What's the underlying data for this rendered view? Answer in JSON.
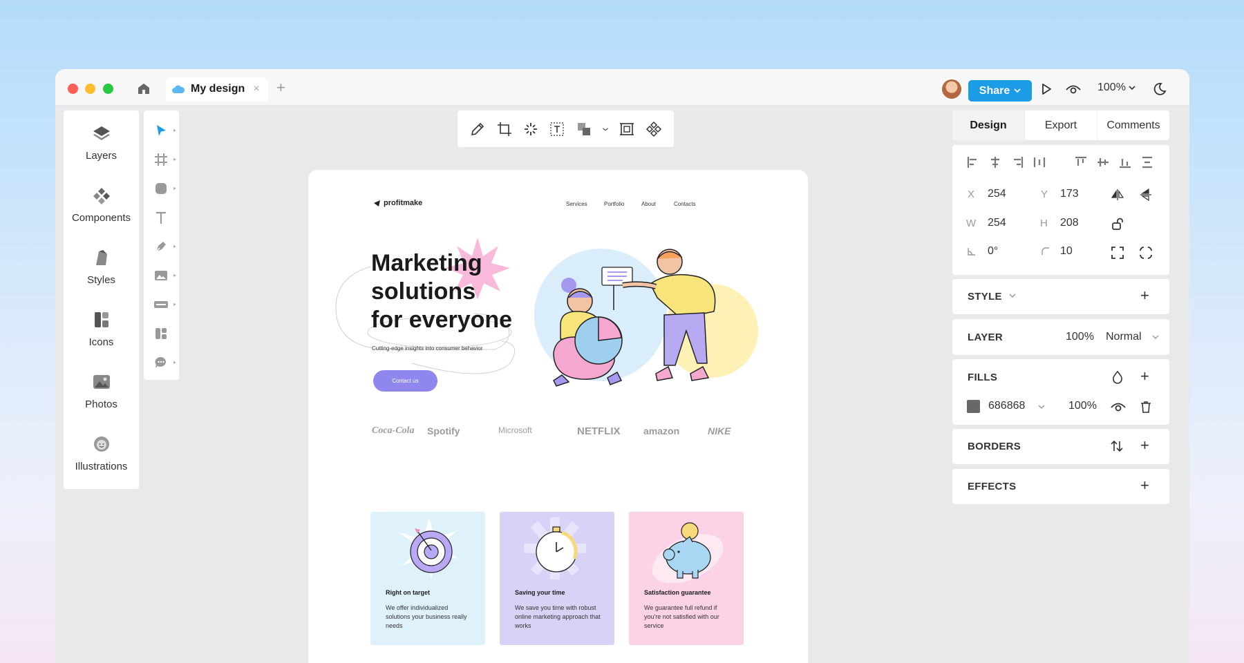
{
  "titlebar": {
    "tab_title": "My design",
    "tab_close": "×",
    "tab_add": "+",
    "share_label": "Share",
    "zoom_label": "100%"
  },
  "left_panel": {
    "items": [
      {
        "label": "Layers",
        "icon": "layers-icon"
      },
      {
        "label": "Components",
        "icon": "components-icon"
      },
      {
        "label": "Styles",
        "icon": "styles-icon"
      },
      {
        "label": "Icons",
        "icon": "icons-icon"
      },
      {
        "label": "Photos",
        "icon": "photos-icon"
      },
      {
        "label": "Illustrations",
        "icon": "illustrations-icon"
      }
    ]
  },
  "tool_rail": {
    "tools": [
      "select-tool",
      "frame-tool",
      "shape-tool",
      "text-tool",
      "pen-tool",
      "image-tool",
      "input-tool",
      "component-tool",
      "comment-tool"
    ]
  },
  "canvas": {
    "logo": "profitmake",
    "nav": [
      "Services",
      "Portfolio",
      "About",
      "Contacts"
    ],
    "hero_title_line1": "Marketing",
    "hero_title_line2": "solutions",
    "hero_title_line3": "for everyone",
    "hero_sub": "Cutting-edge insights into consumer behavior",
    "cta_label": "Contact us",
    "brands": [
      "Coca-Cola",
      "Spotify",
      "Microsoft",
      "NETFLIX",
      "amazon",
      "NIKE"
    ],
    "cards": [
      {
        "title": "Right on target",
        "text": "We offer individualized solutions your business really needs",
        "bg": "#dff2fb"
      },
      {
        "title": "Saving your time",
        "text": "We save you time with robust online marketing approach that works",
        "bg": "#d6d3f7"
      },
      {
        "title": "Satisfaction guarantee",
        "text": "We guarantee full refund if you're not satisfied with our service",
        "bg": "#fbd2e6"
      }
    ]
  },
  "right_panel": {
    "tabs": [
      "Design",
      "Export",
      "Comments"
    ],
    "x_label": "X",
    "x_value": "254",
    "y_label": "Y",
    "y_value": "173",
    "w_label": "W",
    "w_value": "254",
    "h_label": "H",
    "h_value": "208",
    "rotation_value": "0°",
    "radius_value": "10",
    "style_title": "STYLE",
    "layer_title": "LAYER",
    "layer_opacity": "100%",
    "layer_blend": "Normal",
    "fills_title": "FILLS",
    "fill_hex": "686868",
    "fill_color": "#686868",
    "fill_opacity": "100%",
    "borders_title": "BORDERS",
    "effects_title": "EFFECTS"
  },
  "colors": {
    "accent": "#1c9be6",
    "cta": "#8f86ee"
  }
}
